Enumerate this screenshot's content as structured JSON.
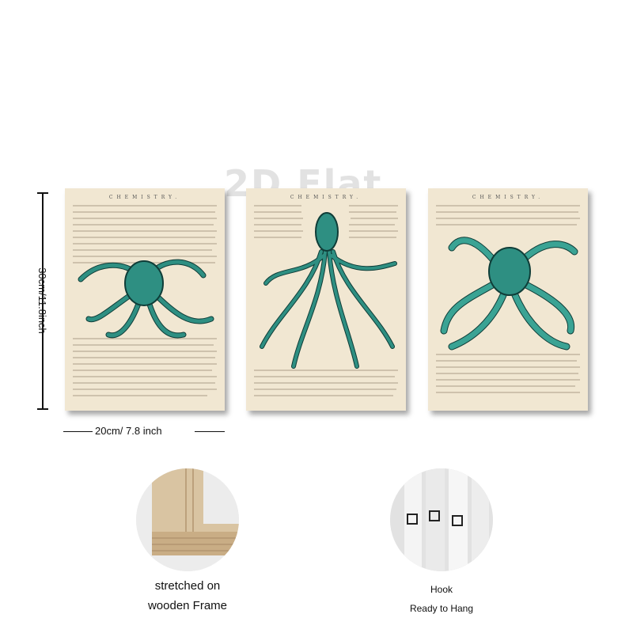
{
  "watermark": "2D Flat",
  "panels": [
    {
      "header": "CHEMISTRY."
    },
    {
      "header": "CHEMISTRY."
    },
    {
      "header": "CHEMISTRY."
    }
  ],
  "dimensions": {
    "height_label": "30cm/11.8inch",
    "width_label": "20cm/ 7.8 inch"
  },
  "details": {
    "frame_caption_line1": "stretched on",
    "frame_caption_line2": "wooden Frame",
    "hook_caption": "Hook",
    "hang_caption": "Ready to Hang"
  },
  "colors": {
    "paper": "#f1e7d2",
    "octopus": "#2e8f82",
    "octopus_dark": "#0f3d38",
    "text": "#111111"
  }
}
